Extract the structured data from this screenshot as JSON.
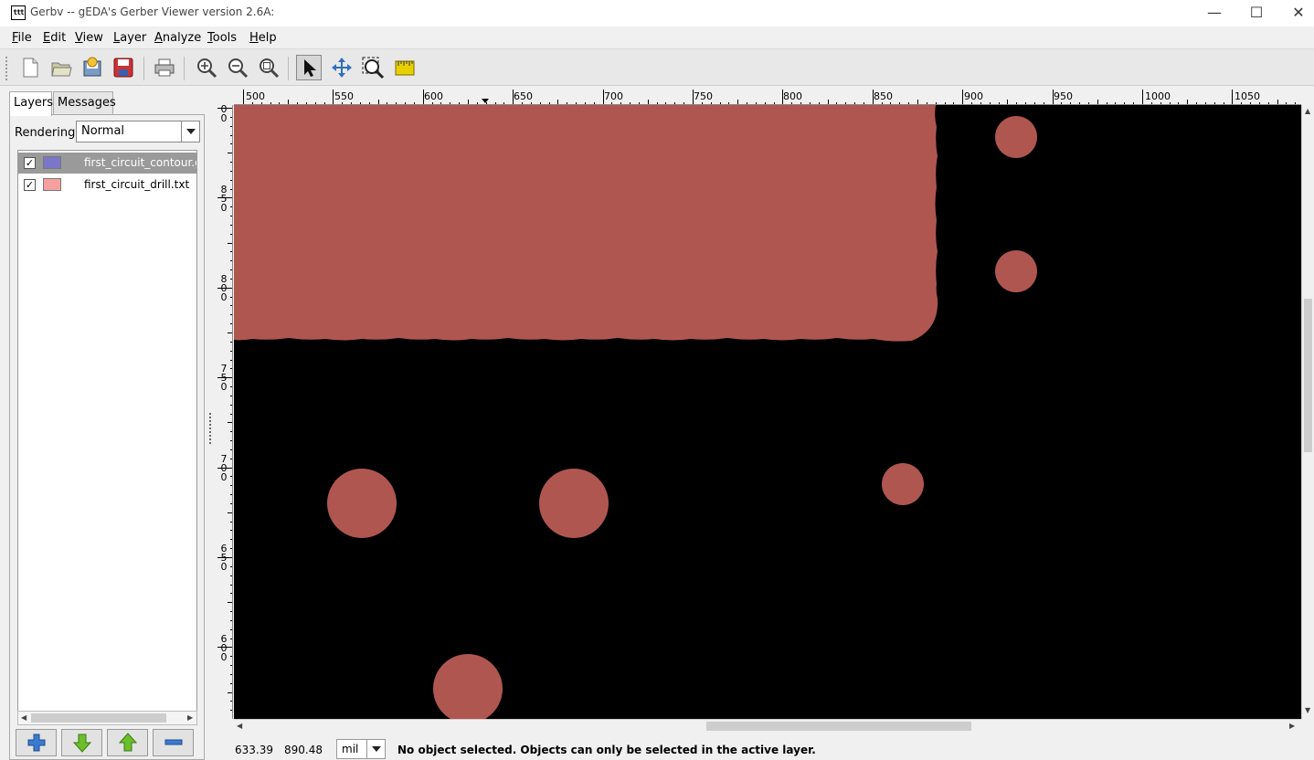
{
  "window": {
    "title": "Gerbv -- gEDA's Gerber Viewer version 2.6A:",
    "app_icon_text": "ttt",
    "minimize": "—",
    "maximize": "☐",
    "close": "✕"
  },
  "menu": {
    "file": {
      "first": "F",
      "rest": "ile"
    },
    "edit": {
      "first": "E",
      "rest": "dit"
    },
    "view": {
      "first": "V",
      "rest": "iew"
    },
    "layer": {
      "first": "L",
      "rest": "ayer"
    },
    "analyze": {
      "first": "A",
      "rest": "nalyze"
    },
    "tools": {
      "first": "T",
      "rest": "ools"
    },
    "help": {
      "first": "H",
      "rest": "elp"
    }
  },
  "sidebar": {
    "tabs": {
      "layers": "Layers",
      "messages": "Messages"
    },
    "rendering_label": "Rendering:",
    "rendering_value": "Normal",
    "layers": [
      {
        "name": "first_circuit_contour.g",
        "color": "#7b76c8",
        "checked": "✓"
      },
      {
        "name": "first_circuit_drill.txt",
        "color": "#f6a0a0",
        "checked": "✓"
      }
    ]
  },
  "rulers": {
    "x_labels": [
      "500",
      "550",
      "600",
      "650",
      "700",
      "750",
      "800",
      "850",
      "900",
      "950",
      "1000",
      "1050"
    ],
    "y_labels": [
      [
        "0",
        "0"
      ],
      [
        "8",
        "5",
        "0"
      ],
      [
        "8",
        "0",
        "0"
      ],
      [
        "7",
        "5",
        "0"
      ],
      [
        "7",
        "0",
        "0"
      ],
      [
        "6",
        "5",
        "0"
      ],
      [
        "6",
        "0",
        "0"
      ]
    ]
  },
  "colors": {
    "canvas_bg": "#000000",
    "copper": "#b05650",
    "selected_row": "#9a9a9a"
  },
  "statusbar": {
    "x": "633.39",
    "y": "890.48",
    "unit": "mil",
    "message": "No object selected. Objects can only be selected in the active layer."
  }
}
